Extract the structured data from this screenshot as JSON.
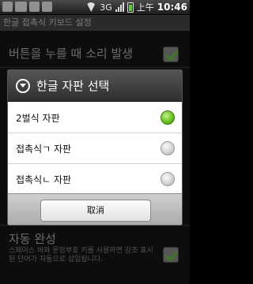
{
  "status_bar": {
    "network_type": "3G",
    "ampm": "上午",
    "time": "10:46"
  },
  "background": {
    "title": "한글 접촉식 키보드 설정",
    "items": [
      {
        "title": "버튼을 누를 때 소리 발생",
        "checked": true
      },
      {
        "title": "자동 완성",
        "subtitle": "스페이스 바와 문장부호 키를 사용하면 강조 표시된 단어가 자동으로 삽입됩니다.",
        "checked": true
      }
    ]
  },
  "dialog": {
    "title": "한글 자판 선택",
    "options": [
      {
        "label": "2벌식 자판",
        "selected": true
      },
      {
        "label": "접촉식ㄱ 자판",
        "selected": false
      },
      {
        "label": "접촉식ㄴ 자판",
        "selected": false
      }
    ],
    "cancel_label": "取消"
  },
  "colors": {
    "selected_radio": "#65c51c",
    "header": "#3b3b3b"
  }
}
